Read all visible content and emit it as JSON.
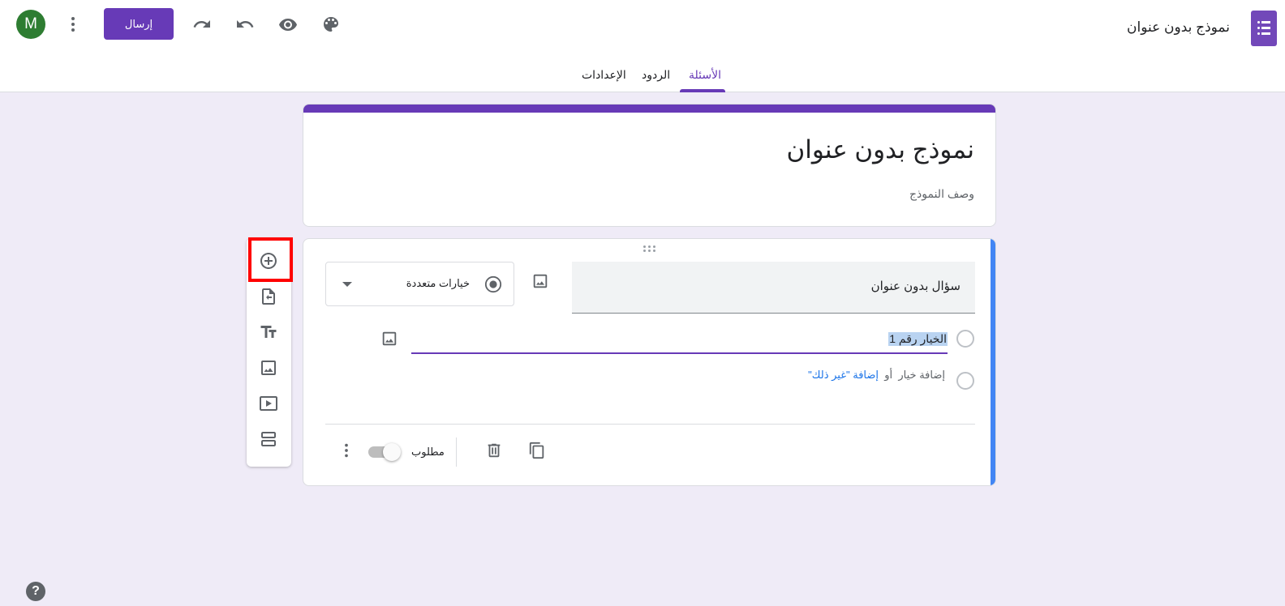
{
  "header": {
    "doc_title": "نموذج بدون عنوان",
    "send_label": "إرسال",
    "avatar_letter": "M",
    "avatar_color": "#2e7d32",
    "brand_color": "#673ab7"
  },
  "tabs": [
    {
      "label": "الأسئلة",
      "active": true
    },
    {
      "label": "الردود",
      "active": false
    },
    {
      "label": "الإعدادات",
      "active": false
    }
  ],
  "form": {
    "title": "نموذج بدون عنوان",
    "description_placeholder": "وصف النموذج"
  },
  "question": {
    "title": "سؤال بدون عنوان",
    "type_label": "خيارات متعددة",
    "option_1": "الخيار رقم 1",
    "add_option": "إضافة خيار",
    "or": "أو",
    "add_other": "إضافة \"غير ذلك\"",
    "required_label": "مطلوب",
    "required": false
  },
  "side_toolbar": {
    "items": [
      "add-question-icon",
      "import-questions-icon",
      "add-title-icon",
      "add-image-icon",
      "add-video-icon",
      "add-section-icon"
    ],
    "highlighted": "add-question-icon",
    "highlight_color": "#ff0000"
  },
  "help_label": "?"
}
